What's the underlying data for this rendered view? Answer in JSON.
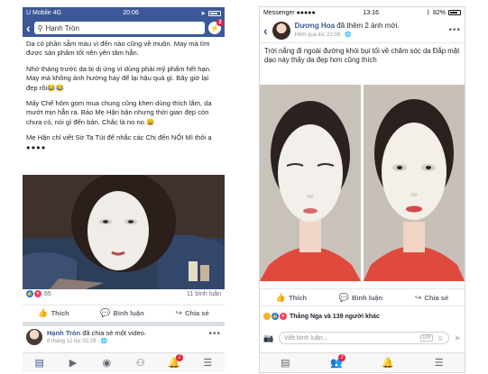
{
  "left_phone": {
    "status": {
      "carrier": "U Mobile",
      "network": "4G",
      "time": "20:06"
    },
    "search": {
      "value": "Hạnh Tròn",
      "messenger_badge": "2"
    },
    "post_text": [
      "Da có phần sẫm màu vì đến nào cũng về muộn. May mà tìm được sản phẩm tốt nên yên tâm hẳn.",
      "Nhớ tháng trước da bị dị ứng vì dùng phải mỹ phẩm hết hạn. May mà không ảnh hưởng hay để lại hậu quả gì. Bây giờ lại đẹp rồi😂😂",
      "Mấy Chế hôm gom mua chung cũng khen dùng thích lắm, da mướt mịn hẳn ra. Bảo Mẹ Hận bận nhưng thời gian đẹp còn chưa có, nói gì đến bản. Chắc là no no.😀",
      "Mẹ Hận chỉ viết Sờ Ta Tút để nhắc các Chị đến NỐI Mì thôi ạ"
    ],
    "post_text_more": "●●●●",
    "reaction_count": "65",
    "comment_count": "11 bình luận",
    "actions": {
      "like": "Thích",
      "comment": "Bình luận",
      "share": "Chia sẻ"
    },
    "next_post": {
      "name": "Hạnh Tròn",
      "verb": "đã chia sẻ một video.",
      "time": "8 tháng 12 lúc 02:29 · 🌐"
    },
    "tab_badge": "2"
  },
  "right_phone": {
    "status": {
      "carrier": "Messenger ●●●●● ",
      "time": "13:16",
      "battery": "82%"
    },
    "header": {
      "name": "Dương Hoa",
      "verb": "đã thêm 2 ảnh mới.",
      "time": "Hôm qua lúc 22:08 · 🌐"
    },
    "caption": "Trời nắng đi ngoài đường khói bụi tối về chăm sóc da Đắp mặt dạo này thấy da đẹp hơn cũng thích",
    "actions": {
      "like": "Thích",
      "comment": "Bình luận",
      "share": "Chia sẻ"
    },
    "reactions_text": "Thắng Nga và 139 người khác",
    "comment_placeholder": "Viết bình luận...",
    "comment_gif": "GIF",
    "tab_badge": "2"
  },
  "colors": {
    "facebook_blue": "#3b5998",
    "link_blue": "#365899",
    "badge_red": "#e41e3f"
  }
}
